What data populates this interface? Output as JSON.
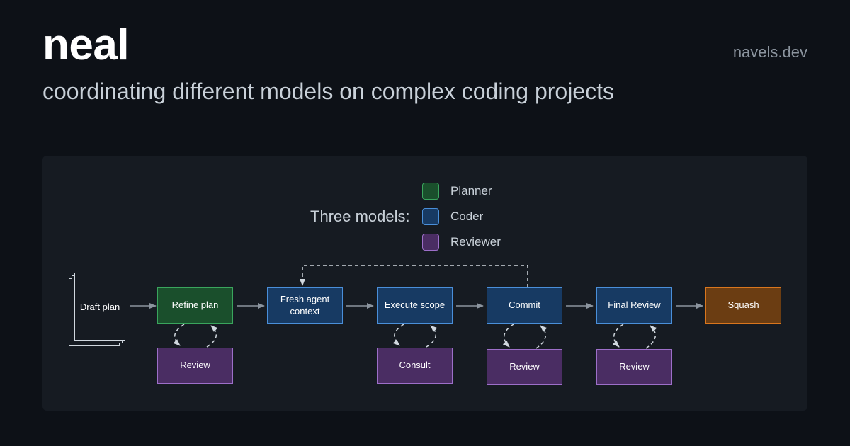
{
  "header": {
    "title": "neal",
    "site": "navels.dev",
    "subtitle": "coordinating different models on complex coding projects"
  },
  "legend": {
    "title": "Three models:",
    "items": [
      {
        "label": "Planner",
        "color": "#1a4f2c",
        "border": "#3aa55d"
      },
      {
        "label": "Coder",
        "color": "#173a63",
        "border": "#4a8fd9"
      },
      {
        "label": "Reviewer",
        "color": "#4a2d63",
        "border": "#9d6fc9"
      }
    ]
  },
  "flow": {
    "draft": "Draft plan",
    "refine": "Refine plan",
    "fresh": "Fresh agent context",
    "execute": "Execute scope",
    "commit": "Commit",
    "final_review": "Final Review",
    "squash": "Squash",
    "review_1": "Review",
    "consult": "Consult",
    "review_2": "Review",
    "review_3": "Review"
  },
  "colors": {
    "background": "#0d1117",
    "panel": "#161b22",
    "connector": "#8b949e",
    "squash": "#6b3d12"
  }
}
